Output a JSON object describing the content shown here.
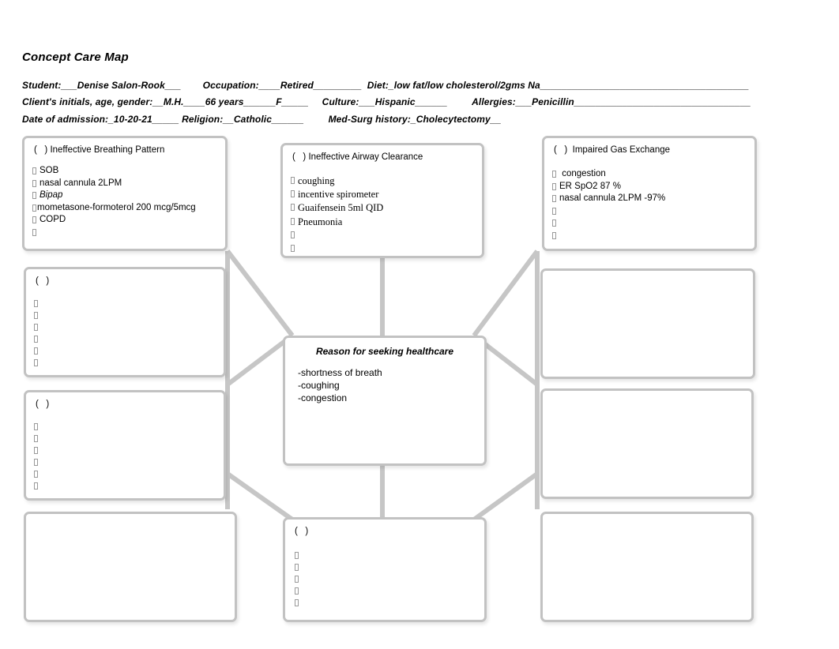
{
  "document": {
    "title": "Concept Care Map"
  },
  "header": {
    "line1": {
      "student_label": "Student:",
      "student_value": "___Denise Salon-Rook___",
      "occupation_label": "Occupation:",
      "occupation_value": "____Retired_________",
      "diet_label": "Diet:",
      "diet_value": "_low fat/low cholesterol/2gms Na_______________________________________"
    },
    "line2": {
      "initials_label": "Client's initials, age, gender:",
      "initials_value": "__M.H.____66 years______F_____",
      "culture_label": "Culture:",
      "culture_value": "___Hispanic______",
      "allergies_label": "Allergies:",
      "allergies_value": "___Penicillin_________________________________"
    },
    "line3": {
      "admission_label": "Date of admission:",
      "admission_value": "_10-20-21_____",
      "religion_label": "Religion:",
      "religion_value": "__Catholic______",
      "medsurg_label": "Med-Surg history:",
      "medsurg_value": "_Cholecytectomy__"
    }
  },
  "nodes": {
    "breathing_pattern": {
      "title": "(   ) Ineffective Breathing Pattern",
      "items": [
        "SOB",
        "nasal cannula 2LPM",
        "Bipap",
        "mometasone-formoterol 200 mcg/5mcg",
        "COPD",
        ""
      ]
    },
    "airway_clearance": {
      "title": "(   ) Ineffective Airway Clearance",
      "items": [
        "coughing",
        "incentive spirometer",
        "Guaifensein 5ml QID",
        "Pneumonia",
        "",
        ""
      ]
    },
    "gas_exchange": {
      "title": "(   )  Impaired Gas Exchange",
      "items": [
        " congestion",
        "ER SpO2 87 %",
        "nasal cannula 2LPM -97%",
        "",
        "",
        ""
      ]
    },
    "middle_left": {
      "title": "(   )",
      "items": [
        "",
        "",
        "",
        "",
        "",
        ""
      ]
    },
    "lower_left": {
      "title": "(   )",
      "items": [
        "",
        "",
        "",
        "",
        "",
        ""
      ]
    },
    "bottom_center": {
      "title": "(   )",
      "items": [
        "",
        "",
        "",
        "",
        ""
      ]
    },
    "middle_right": {
      "title": "",
      "items": []
    },
    "lower_right": {
      "title": "",
      "items": []
    },
    "bottom_left": {
      "title": "",
      "items": []
    },
    "bottom_right": {
      "title": "",
      "items": []
    },
    "reason": {
      "title": "Reason for seeking healthcare",
      "items": [
        "-shortness of breath",
        "-coughing",
        "-congestion"
      ]
    }
  },
  "colors": {
    "box_border": "#c2c2c2",
    "connector": "#c6c6c6",
    "text": "#000000",
    "bullet": "#9a9a9a"
  }
}
